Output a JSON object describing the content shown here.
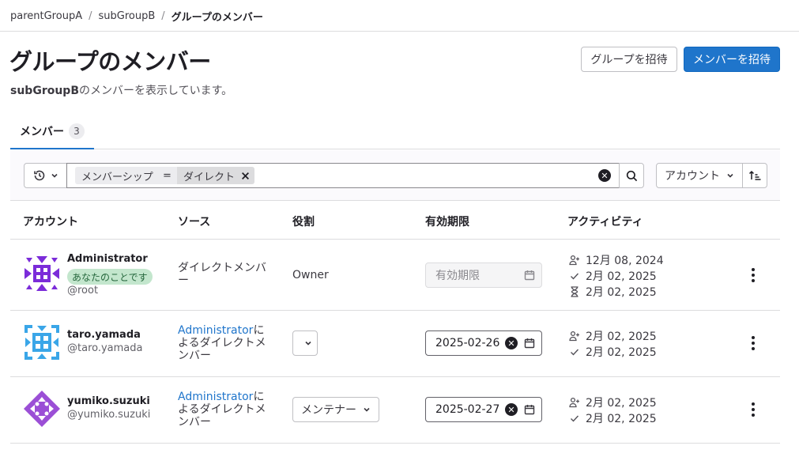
{
  "breadcrumb": {
    "items": [
      "parentGroupA",
      "subGroupB"
    ],
    "current": "グループのメンバー",
    "separator": "/"
  },
  "page": {
    "title": "グループのメンバー",
    "subtitle_group": "subGroupB",
    "subtitle_rest": "のメンバーを表示しています。"
  },
  "buttons": {
    "invite_group": "グループを招待",
    "invite_member": "メンバーを招待"
  },
  "tabs": [
    {
      "label": "メンバー",
      "count": "3"
    }
  ],
  "filter": {
    "token_key": "メンバーシップ",
    "token_op": "=",
    "token_value": "ダイレクト",
    "sort_label": "アカウント"
  },
  "table": {
    "headers": [
      "アカウント",
      "ソース",
      "役割",
      "有効期限",
      "アクティビティ"
    ],
    "rows": [
      {
        "name": "Administrator",
        "badge": "あなたのことです",
        "handle": "@root",
        "source_text": "ダイレクトメンバー",
        "role": "Owner",
        "expiry_placeholder": "有効期限",
        "activity": [
          "12月 08, 2024",
          "2月 02, 2025",
          "2月 02, 2025"
        ],
        "avatar_color": "#7b2cd9"
      },
      {
        "name": "taro.yamada",
        "handle": "@taro.yamada",
        "source_link": "Administrator",
        "source_text": "によるダイレクトメンバー",
        "role": "",
        "expiry": "2025-02-26",
        "activity": [
          "2月 02, 2025",
          "2月 02, 2025"
        ],
        "avatar_color": "#3aa6e8"
      },
      {
        "name": "yumiko.suzuki",
        "handle": "@yumiko.suzuki",
        "source_link": "Administrator",
        "source_text": "によるダイレクトメンバー",
        "role": "メンテナー",
        "expiry": "2025-02-27",
        "activity": [
          "2月 02, 2025",
          "2月 02, 2025"
        ],
        "avatar_color": "#9b4fd6"
      }
    ]
  },
  "colors": {
    "primary": "#1f75cb",
    "badge_bg": "#c3e6cd",
    "badge_text": "#24663b"
  }
}
